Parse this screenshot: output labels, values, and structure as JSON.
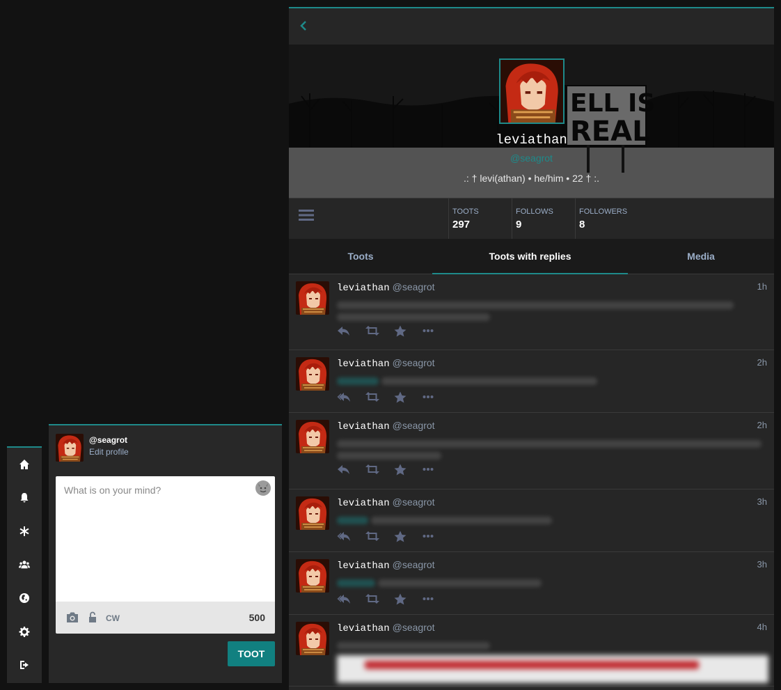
{
  "profile": {
    "display_name": "leviathan",
    "acct": "@seagrot",
    "bio": ".: † levi(athan) • he/him • 22 † :.",
    "stats": [
      {
        "label": "TOOTS",
        "value": "297"
      },
      {
        "label": "FOLLOWS",
        "value": "9"
      },
      {
        "label": "FOLLOWERS",
        "value": "8"
      }
    ],
    "header_sign_text": [
      "ELL IS",
      "REAL"
    ]
  },
  "tabs": [
    "Toots",
    "Toots with replies",
    "Media"
  ],
  "active_tab": "Toots with replies",
  "statuses": [
    {
      "name": "leviathan",
      "acct": "@seagrot",
      "time": "1h"
    },
    {
      "name": "leviathan",
      "acct": "@seagrot",
      "time": "2h"
    },
    {
      "name": "leviathan",
      "acct": "@seagrot",
      "time": "2h"
    },
    {
      "name": "leviathan",
      "acct": "@seagrot",
      "time": "3h"
    },
    {
      "name": "leviathan",
      "acct": "@seagrot",
      "time": "3h"
    },
    {
      "name": "leviathan",
      "acct": "@seagrot",
      "time": "4h"
    }
  ],
  "compose": {
    "handle": "@seagrot",
    "edit_profile": "Edit profile",
    "placeholder": "What is on your mind?",
    "cw_label": "CW",
    "char_count": "500",
    "submit_label": "TOOT"
  },
  "nav_icons": [
    "home-icon",
    "bell-icon",
    "asterisk-icon",
    "users-icon",
    "globe-icon",
    "gear-icon",
    "sign-out-icon"
  ],
  "colors": {
    "accent": "#1e8a8a",
    "button": "#118080",
    "background": "#121212",
    "column": "#262626"
  }
}
